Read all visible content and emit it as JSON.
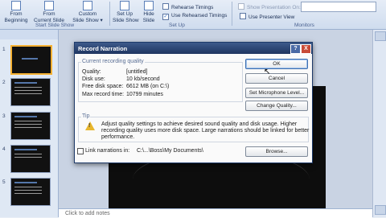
{
  "ribbon": {
    "buttons": [
      {
        "line1": "From",
        "line2": "Beginning"
      },
      {
        "line1": "From",
        "line2": "Current Slide"
      },
      {
        "line1": "Custom",
        "line2": "Slide Show ▾"
      },
      {
        "line1": "Set Up",
        "line2": "Slide Show"
      },
      {
        "line1": "Hide",
        "line2": "Slide"
      }
    ],
    "groups": {
      "start": "Start Slide Show",
      "setup": "Set Up",
      "monitors": "Monitors"
    },
    "checks": {
      "rehearse": "Rehearse Timings",
      "use_rehearsed": "Use Rehearsed Timings",
      "show_on": "Show Presentation On:",
      "presenter_view": "Use Presenter View"
    }
  },
  "pane": {
    "thumbs": [
      {
        "num": "1"
      },
      {
        "num": "2"
      },
      {
        "num": "3"
      },
      {
        "num": "4"
      },
      {
        "num": "5"
      }
    ]
  },
  "notes": {
    "placeholder": "Click to add notes"
  },
  "dialog": {
    "title": "Record Narration",
    "help_glyph": "?",
    "close_glyph": "X",
    "current_quality_legend": "Current recording quality",
    "rows": [
      {
        "label": "Quality:",
        "value": "[untitled]"
      },
      {
        "label": "Disk use:",
        "value": "10 kb/second"
      },
      {
        "label": "Free disk space:",
        "value": "6612 MB (on C:\\)"
      },
      {
        "label": "Max record time:",
        "value": "10799 minutes"
      }
    ],
    "buttons": {
      "ok": "OK",
      "cancel": "Cancel",
      "set_mic": "Set Microphone Level...",
      "change_quality": "Change Quality...",
      "browse": "Browse..."
    },
    "tip_legend": "Tip",
    "tip_text_1": "Adjust quality settings to achieve desired sound quality and disk usage. Higher",
    "tip_text_2": "recording quality uses more disk space. Large narrations should be linked for better",
    "tip_text_3": "performance.",
    "link_label": "Link narrations in:",
    "link_path": "C:\\...\\Boss\\My Documents\\"
  }
}
